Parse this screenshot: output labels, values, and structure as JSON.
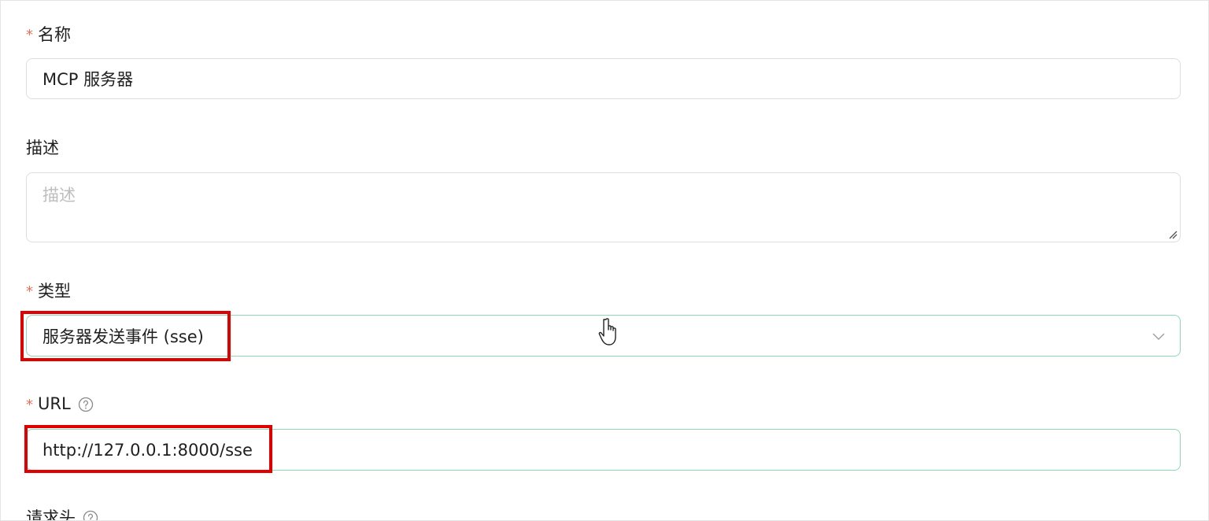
{
  "form": {
    "name": {
      "label": "名称",
      "required_mark": "*",
      "value": "MCP 服务器"
    },
    "description": {
      "label": "描述",
      "placeholder": "描述"
    },
    "type": {
      "label": "类型",
      "required_mark": "*",
      "selected": "服务器发送事件 (sse)"
    },
    "url": {
      "label": "URL",
      "required_mark": "*",
      "value": "http://127.0.0.1:8000/sse"
    },
    "headers": {
      "label": "请求头"
    }
  },
  "colors": {
    "required": "#e8705a",
    "focus_border": "#8ed8b5",
    "highlight": "#e00000"
  }
}
